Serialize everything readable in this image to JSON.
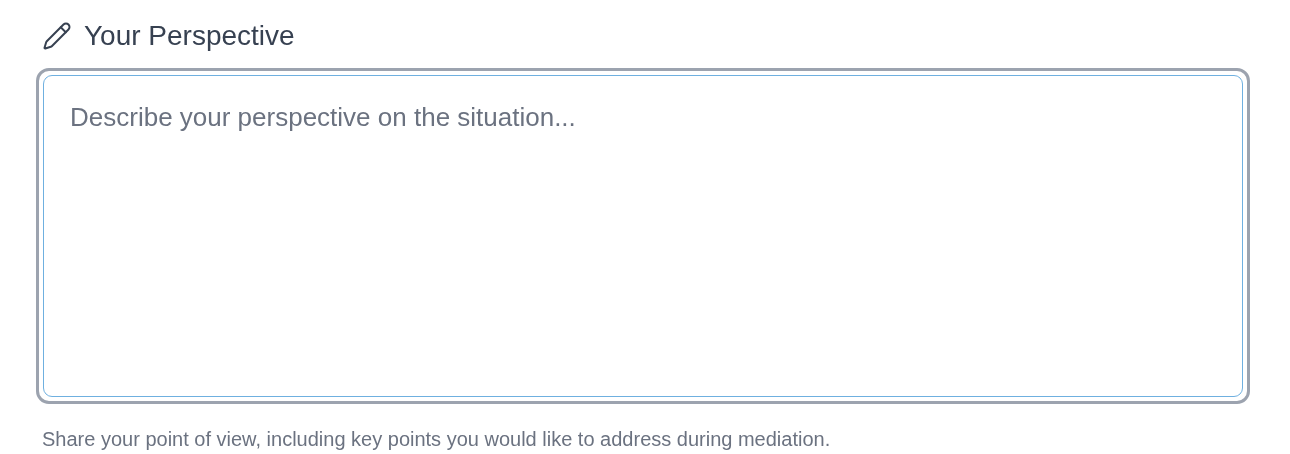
{
  "field": {
    "label": "Your Perspective",
    "placeholder": "Describe your perspective on the situation...",
    "focused": true,
    "help": "Share your point of view, including key points you would like to address during mediation."
  }
}
